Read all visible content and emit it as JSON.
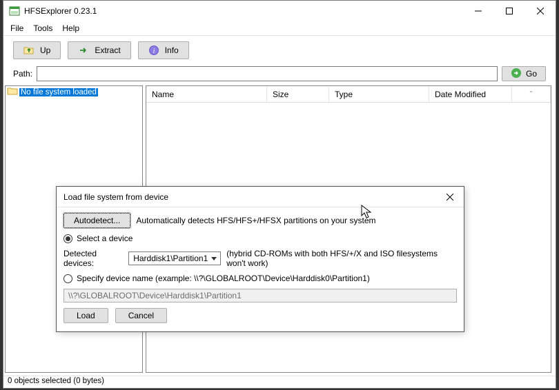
{
  "window": {
    "title": "HFSExplorer 0.23.1"
  },
  "menu": {
    "file": "File",
    "tools": "Tools",
    "help": "Help"
  },
  "toolbar": {
    "up": "Up",
    "extract": "Extract",
    "info": "Info"
  },
  "path": {
    "label": "Path:",
    "value": "",
    "go": "Go"
  },
  "tree": {
    "root": "No file system loaded"
  },
  "columns": {
    "name": "Name",
    "size": "Size",
    "type": "Type",
    "date": "Date Modified",
    "sort_indicator": "ˆ"
  },
  "status": "0 objects selected (0 bytes)",
  "dialog": {
    "title": "Load file system from device",
    "autodetect": "Autodetect...",
    "autodetect_help": "Automatically detects HFS/HFS+/HFSX partitions on your system",
    "select_device": "Select a device",
    "detected_label": "Detected devices:",
    "detected_value": "Harddisk1\\Partition1",
    "detected_note": "(hybrid CD-ROMs with both HFS/+/X and ISO filesystems won't work)",
    "specify_label": "Specify device name (example: \\\\?\\GLOBALROOT\\Device\\Harddisk0\\Partition1)",
    "specify_value": "\\\\?\\GLOBALROOT\\Device\\Harddisk1\\Partition1",
    "load": "Load",
    "cancel": "Cancel"
  }
}
